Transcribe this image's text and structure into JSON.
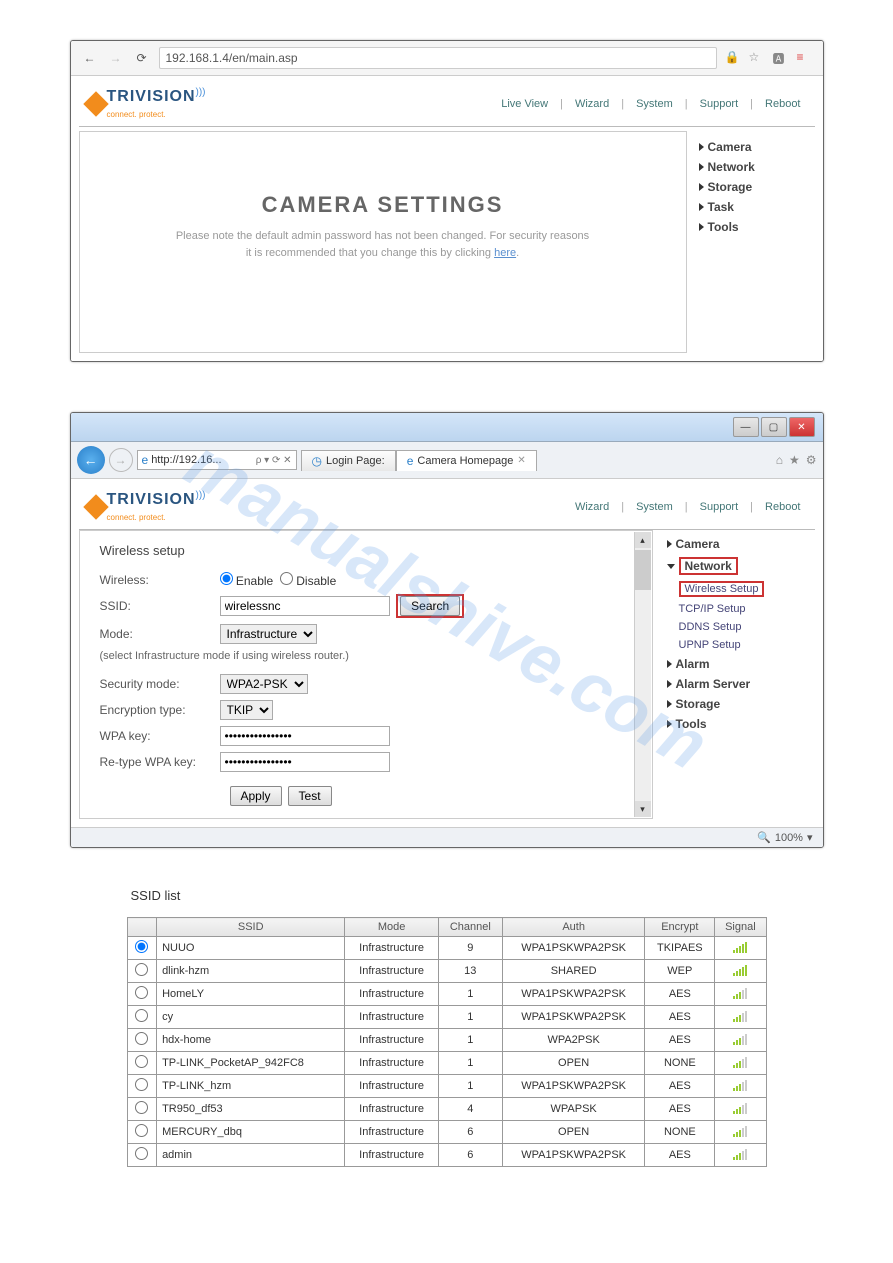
{
  "win1": {
    "url": "192.168.1.4/en/main.asp",
    "brand": "TRIVISION",
    "brand_sub": "connect. protect.",
    "toplinks": [
      "Live View",
      "Wizard",
      "System",
      "Support",
      "Reboot"
    ],
    "navitems": [
      "Camera",
      "Network",
      "Storage",
      "Task",
      "Tools"
    ],
    "title": "CAMERA SETTINGS",
    "note1": "Please note the default admin password has not been changed. For security reasons",
    "note2": "it is recommended that you change this by clicking ",
    "here": "here"
  },
  "win2": {
    "url": "http://192.16...",
    "searchctl": "ρ ▾ ⟳ ✕",
    "tab1": "Login Page:",
    "tab2": "Camera Homepage",
    "brand": "TRIVISION",
    "brand_sub": "connect. protect.",
    "toplinks": [
      "Wizard",
      "System",
      "Support",
      "Reboot"
    ],
    "heading": "Wireless setup",
    "form": {
      "wireless_lbl": "Wireless:",
      "enable": "Enable",
      "disable": "Disable",
      "ssid_lbl": "SSID:",
      "ssid_val": "wirelessnc",
      "search": "Search",
      "mode_lbl": "Mode:",
      "mode_val": "Infrastructure",
      "hint": "(select Infrastructure mode if using wireless router.)",
      "secmode_lbl": "Security mode:",
      "secmode_val": "WPA2-PSK",
      "enc_lbl": "Encryption type:",
      "enc_val": "TKIP",
      "wpa_lbl": "WPA key:",
      "wpa_val": "••••••••••••••••",
      "rewpa_lbl": "Re-type WPA key:",
      "rewpa_val": "••••••••••••••••",
      "apply": "Apply",
      "test": "Test"
    },
    "nav": {
      "camera": "Camera",
      "network": "Network",
      "wireless": "Wireless Setup",
      "tcpip": "TCP/IP Setup",
      "ddns": "DDNS Setup",
      "upnp": "UPNP Setup",
      "alarm": "Alarm",
      "alarmserver": "Alarm Server",
      "storage": "Storage",
      "tools": "Tools"
    },
    "zoom": "100%"
  },
  "ssid": {
    "title": "SSID list",
    "headers": [
      "",
      "SSID",
      "Mode",
      "Channel",
      "Auth",
      "Encrypt",
      "Signal"
    ],
    "rows": [
      {
        "sel": true,
        "ssid": "NUUO",
        "mode": "Infrastructure",
        "ch": "9",
        "auth": "WPA1PSKWPA2PSK",
        "enc": "TKIPAES",
        "sig": 5
      },
      {
        "sel": false,
        "ssid": "dlink-hzm",
        "mode": "Infrastructure",
        "ch": "13",
        "auth": "SHARED",
        "enc": "WEP",
        "sig": 4
      },
      {
        "sel": false,
        "ssid": "HomeLY",
        "mode": "Infrastructure",
        "ch": "1",
        "auth": "WPA1PSKWPA2PSK",
        "enc": "AES",
        "sig": 3
      },
      {
        "sel": false,
        "ssid": "cy",
        "mode": "Infrastructure",
        "ch": "1",
        "auth": "WPA1PSKWPA2PSK",
        "enc": "AES",
        "sig": 3
      },
      {
        "sel": false,
        "ssid": "hdx-home",
        "mode": "Infrastructure",
        "ch": "1",
        "auth": "WPA2PSK",
        "enc": "AES",
        "sig": 3
      },
      {
        "sel": false,
        "ssid": "TP-LINK_PocketAP_942FC8",
        "mode": "Infrastructure",
        "ch": "1",
        "auth": "OPEN",
        "enc": "NONE",
        "sig": 3
      },
      {
        "sel": false,
        "ssid": "TP-LINK_hzm",
        "mode": "Infrastructure",
        "ch": "1",
        "auth": "WPA1PSKWPA2PSK",
        "enc": "AES",
        "sig": 3
      },
      {
        "sel": false,
        "ssid": "TR950_df53",
        "mode": "Infrastructure",
        "ch": "4",
        "auth": "WPAPSK",
        "enc": "AES",
        "sig": 3
      },
      {
        "sel": false,
        "ssid": "MERCURY_dbq",
        "mode": "Infrastructure",
        "ch": "6",
        "auth": "OPEN",
        "enc": "NONE",
        "sig": 3
      },
      {
        "sel": false,
        "ssid": "admin",
        "mode": "Infrastructure",
        "ch": "6",
        "auth": "WPA1PSKWPA2PSK",
        "enc": "AES",
        "sig": 3
      }
    ]
  },
  "watermark": "manualshive.com"
}
